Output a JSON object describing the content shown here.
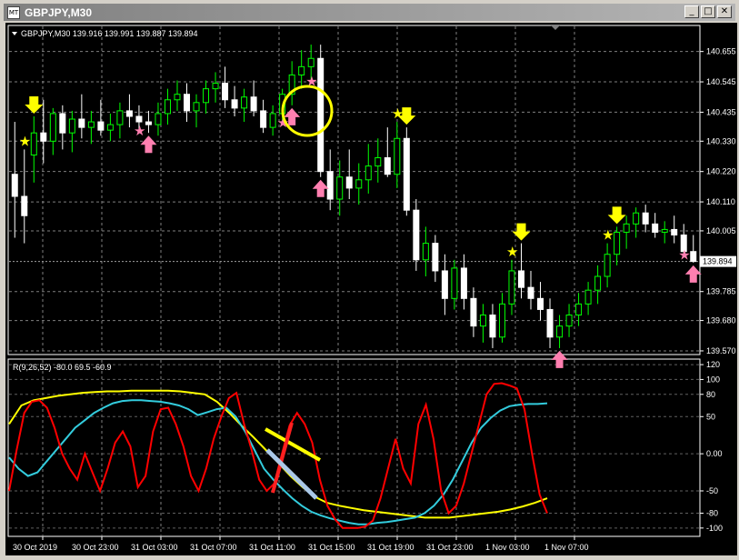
{
  "window": {
    "title": "GBPJPY,M30",
    "icon_label": "MT",
    "icon_name": "chart-window-icon",
    "buttons": [
      "minimize-icon",
      "restore-icon",
      "close-icon"
    ]
  },
  "price_panel": {
    "header": "GBPJPY,M30  139.916 139.991 139.887 139.894",
    "symbol": "GBPJPY,M30",
    "ohlc": [
      "139.916",
      "139.991",
      "139.887",
      "139.894"
    ],
    "current_price": "139.894",
    "y_labels": [
      "140.655",
      "140.545",
      "140.435",
      "140.330",
      "140.220",
      "140.110",
      "140.005",
      "139.785",
      "139.680",
      "139.570"
    ],
    "colors": {
      "bull": "#00ff00",
      "bear": "#ffffff",
      "grid": "#808080",
      "buy_arrow": "#ff7fb0",
      "sell_arrow": "#ffff00",
      "circle": "#ffff00"
    }
  },
  "indicator_panel": {
    "label": "R(9,26,52) -80.0 69.5 -60.9",
    "y_labels": [
      "120",
      "100",
      "80",
      "50",
      "0.00",
      "-50",
      "-80",
      "-100"
    ],
    "colors": {
      "fast": "#ff0000",
      "mid": "#33ccdd",
      "slow": "#ffff00"
    }
  },
  "time_axis": [
    "30 Oct 2019",
    "30 Oct 23:00",
    "31 Oct 03:00",
    "31 Oct 07:00",
    "31 Oct 11:00",
    "31 Oct 15:00",
    "31 Oct 19:00",
    "31 Oct 23:00",
    "1 Nov 03:00",
    "1 Nov 07:00"
  ],
  "chart_data": {
    "type": "candlestick",
    "symbol": "GBPJPY",
    "timeframe": "M30",
    "ylim": [
      139.56,
      140.7
    ],
    "candles": [
      {
        "o": 140.21,
        "h": 140.4,
        "l": 139.98,
        "c": 140.13
      },
      {
        "o": 140.13,
        "h": 140.3,
        "l": 139.96,
        "c": 140.06
      },
      {
        "o": 140.28,
        "h": 140.42,
        "l": 140.18,
        "c": 140.36
      },
      {
        "o": 140.36,
        "h": 140.48,
        "l": 140.25,
        "c": 140.33
      },
      {
        "o": 140.33,
        "h": 140.45,
        "l": 140.28,
        "c": 140.43
      },
      {
        "o": 140.43,
        "h": 140.46,
        "l": 140.3,
        "c": 140.36
      },
      {
        "o": 140.36,
        "h": 140.44,
        "l": 140.29,
        "c": 140.41
      },
      {
        "o": 140.41,
        "h": 140.5,
        "l": 140.34,
        "c": 140.38
      },
      {
        "o": 140.38,
        "h": 140.44,
        "l": 140.32,
        "c": 140.4
      },
      {
        "o": 140.4,
        "h": 140.48,
        "l": 140.35,
        "c": 140.37
      },
      {
        "o": 140.37,
        "h": 140.43,
        "l": 140.33,
        "c": 140.39
      },
      {
        "o": 140.39,
        "h": 140.47,
        "l": 140.34,
        "c": 140.44
      },
      {
        "o": 140.44,
        "h": 140.5,
        "l": 140.38,
        "c": 140.42
      },
      {
        "o": 140.42,
        "h": 140.46,
        "l": 140.37,
        "c": 140.4
      },
      {
        "o": 140.4,
        "h": 140.44,
        "l": 140.36,
        "c": 140.39
      },
      {
        "o": 140.39,
        "h": 140.47,
        "l": 140.35,
        "c": 140.43
      },
      {
        "o": 140.43,
        "h": 140.52,
        "l": 140.39,
        "c": 140.48
      },
      {
        "o": 140.48,
        "h": 140.55,
        "l": 140.44,
        "c": 140.5
      },
      {
        "o": 140.5,
        "h": 140.54,
        "l": 140.4,
        "c": 140.44
      },
      {
        "o": 140.44,
        "h": 140.5,
        "l": 140.38,
        "c": 140.47
      },
      {
        "o": 140.47,
        "h": 140.55,
        "l": 140.43,
        "c": 140.52
      },
      {
        "o": 140.52,
        "h": 140.58,
        "l": 140.47,
        "c": 140.54
      },
      {
        "o": 140.54,
        "h": 140.6,
        "l": 140.45,
        "c": 140.48
      },
      {
        "o": 140.48,
        "h": 140.53,
        "l": 140.42,
        "c": 140.45
      },
      {
        "o": 140.45,
        "h": 140.52,
        "l": 140.4,
        "c": 140.49
      },
      {
        "o": 140.49,
        "h": 140.55,
        "l": 140.42,
        "c": 140.44
      },
      {
        "o": 140.44,
        "h": 140.48,
        "l": 140.36,
        "c": 140.38
      },
      {
        "o": 140.38,
        "h": 140.46,
        "l": 140.35,
        "c": 140.43
      },
      {
        "o": 140.43,
        "h": 140.52,
        "l": 140.4,
        "c": 140.5
      },
      {
        "o": 140.5,
        "h": 140.62,
        "l": 140.46,
        "c": 140.57
      },
      {
        "o": 140.57,
        "h": 140.66,
        "l": 140.52,
        "c": 140.6
      },
      {
        "o": 140.6,
        "h": 140.68,
        "l": 140.55,
        "c": 140.63
      },
      {
        "o": 140.63,
        "h": 140.68,
        "l": 140.2,
        "c": 140.22
      },
      {
        "o": 140.22,
        "h": 140.3,
        "l": 140.08,
        "c": 140.12
      },
      {
        "o": 140.12,
        "h": 140.26,
        "l": 140.06,
        "c": 140.2
      },
      {
        "o": 140.2,
        "h": 140.3,
        "l": 140.12,
        "c": 140.16
      },
      {
        "o": 140.16,
        "h": 140.25,
        "l": 140.1,
        "c": 140.19
      },
      {
        "o": 140.19,
        "h": 140.32,
        "l": 140.14,
        "c": 140.24
      },
      {
        "o": 140.24,
        "h": 140.34,
        "l": 140.18,
        "c": 140.27
      },
      {
        "o": 140.27,
        "h": 140.38,
        "l": 140.2,
        "c": 140.21
      },
      {
        "o": 140.21,
        "h": 140.4,
        "l": 140.16,
        "c": 140.34
      },
      {
        "o": 140.34,
        "h": 140.38,
        "l": 140.06,
        "c": 140.08
      },
      {
        "o": 140.08,
        "h": 140.12,
        "l": 139.86,
        "c": 139.9
      },
      {
        "o": 139.9,
        "h": 140.02,
        "l": 139.84,
        "c": 139.96
      },
      {
        "o": 139.96,
        "h": 139.99,
        "l": 139.82,
        "c": 139.86
      },
      {
        "o": 139.86,
        "h": 139.92,
        "l": 139.7,
        "c": 139.76
      },
      {
        "o": 139.76,
        "h": 139.9,
        "l": 139.72,
        "c": 139.87
      },
      {
        "o": 139.87,
        "h": 139.92,
        "l": 139.72,
        "c": 139.76
      },
      {
        "o": 139.76,
        "h": 139.8,
        "l": 139.62,
        "c": 139.66
      },
      {
        "o": 139.66,
        "h": 139.74,
        "l": 139.6,
        "c": 139.7
      },
      {
        "o": 139.7,
        "h": 139.74,
        "l": 139.58,
        "c": 139.62
      },
      {
        "o": 139.62,
        "h": 139.78,
        "l": 139.6,
        "c": 139.74
      },
      {
        "o": 139.74,
        "h": 139.9,
        "l": 139.7,
        "c": 139.86
      },
      {
        "o": 139.86,
        "h": 139.96,
        "l": 139.76,
        "c": 139.8
      },
      {
        "o": 139.8,
        "h": 139.86,
        "l": 139.72,
        "c": 139.76
      },
      {
        "o": 139.76,
        "h": 139.82,
        "l": 139.68,
        "c": 139.72
      },
      {
        "o": 139.72,
        "h": 139.76,
        "l": 139.58,
        "c": 139.62
      },
      {
        "o": 139.62,
        "h": 139.7,
        "l": 139.58,
        "c": 139.66
      },
      {
        "o": 139.66,
        "h": 139.74,
        "l": 139.62,
        "c": 139.7
      },
      {
        "o": 139.7,
        "h": 139.78,
        "l": 139.66,
        "c": 139.74
      },
      {
        "o": 139.74,
        "h": 139.82,
        "l": 139.7,
        "c": 139.79
      },
      {
        "o": 139.79,
        "h": 139.88,
        "l": 139.74,
        "c": 139.84
      },
      {
        "o": 139.84,
        "h": 139.96,
        "l": 139.8,
        "c": 139.92
      },
      {
        "o": 139.92,
        "h": 140.02,
        "l": 139.88,
        "c": 140.0
      },
      {
        "o": 140.0,
        "h": 140.06,
        "l": 139.94,
        "c": 140.03
      },
      {
        "o": 140.03,
        "h": 140.09,
        "l": 139.98,
        "c": 140.07
      },
      {
        "o": 140.07,
        "h": 140.1,
        "l": 140.0,
        "c": 140.03
      },
      {
        "o": 140.03,
        "h": 140.07,
        "l": 139.98,
        "c": 140.0
      },
      {
        "o": 140.0,
        "h": 140.04,
        "l": 139.96,
        "c": 140.01
      },
      {
        "o": 140.01,
        "h": 140.06,
        "l": 139.96,
        "c": 139.99
      },
      {
        "o": 139.99,
        "h": 140.03,
        "l": 139.92,
        "c": 139.93
      },
      {
        "o": 139.93,
        "h": 139.99,
        "l": 139.89,
        "c": 139.894
      }
    ],
    "signals": [
      {
        "i": 2,
        "kind": "sell-arrow"
      },
      {
        "i": 1,
        "kind": "yellow-star"
      },
      {
        "i": 14,
        "kind": "buy-arrow"
      },
      {
        "i": 13,
        "kind": "pink-star"
      },
      {
        "i": 29,
        "kind": "buy-arrow"
      },
      {
        "i": 28,
        "kind": "pink-star"
      },
      {
        "i": 32,
        "kind": "buy-arrow"
      },
      {
        "i": 31,
        "kind": "pink-star"
      },
      {
        "i": 41,
        "kind": "sell-arrow"
      },
      {
        "i": 40,
        "kind": "yellow-star"
      },
      {
        "i": 53,
        "kind": "sell-arrow"
      },
      {
        "i": 52,
        "kind": "yellow-star"
      },
      {
        "i": 57,
        "kind": "buy-arrow"
      },
      {
        "i": 63,
        "kind": "sell-arrow"
      },
      {
        "i": 62,
        "kind": "yellow-star"
      },
      {
        "i": 71,
        "kind": "buy-arrow"
      },
      {
        "i": 70,
        "kind": "pink-star"
      }
    ],
    "indicator": {
      "name": "R(9,26,52)",
      "ylim": [
        -110,
        125
      ],
      "fast_red": [
        -50,
        5,
        55,
        70,
        72,
        62,
        35,
        0,
        -20,
        -35,
        0,
        -25,
        -50,
        -20,
        15,
        30,
        10,
        -45,
        -30,
        30,
        60,
        62,
        40,
        10,
        -30,
        -50,
        -20,
        20,
        50,
        75,
        82,
        40,
        5,
        -35,
        -50,
        -40,
        0,
        38,
        55,
        40,
        15,
        -35,
        -70,
        -88,
        -100,
        -100,
        -100,
        -98,
        -90,
        -60,
        -20,
        20,
        -20,
        -40,
        40,
        66,
        20,
        -50,
        -80,
        -70,
        -40,
        0,
        40,
        80,
        94,
        95,
        92,
        88,
        60,
        0,
        -55,
        -80
      ],
      "mid_cyan": [
        -5,
        -20,
        -30,
        -25,
        -10,
        5,
        20,
        35,
        45,
        55,
        62,
        68,
        71,
        72,
        72,
        71,
        70,
        68,
        65,
        60,
        52,
        56,
        60,
        62,
        50,
        30,
        5,
        -20,
        -35,
        -48,
        -60,
        -70,
        -78,
        -83,
        -87,
        -90,
        -93,
        -95,
        -95,
        -93,
        -92,
        -90,
        -88,
        -86,
        -80,
        -70,
        -55,
        -35,
        -10,
        15,
        35,
        48,
        58,
        64,
        66,
        67,
        67,
        68
      ],
      "slow_yellow": [
        40,
        65,
        72,
        75,
        78,
        80,
        82,
        83,
        84,
        84,
        85,
        85,
        85,
        85,
        84,
        82,
        80,
        70,
        55,
        38,
        22,
        5,
        -12,
        -30,
        -45,
        -58,
        -66,
        -70,
        -73,
        -76,
        -78,
        -80,
        -82,
        -84,
        -86,
        -86,
        -86,
        -84,
        -82,
        -80,
        -78,
        -75,
        -71,
        -66,
        -60
      ]
    }
  }
}
